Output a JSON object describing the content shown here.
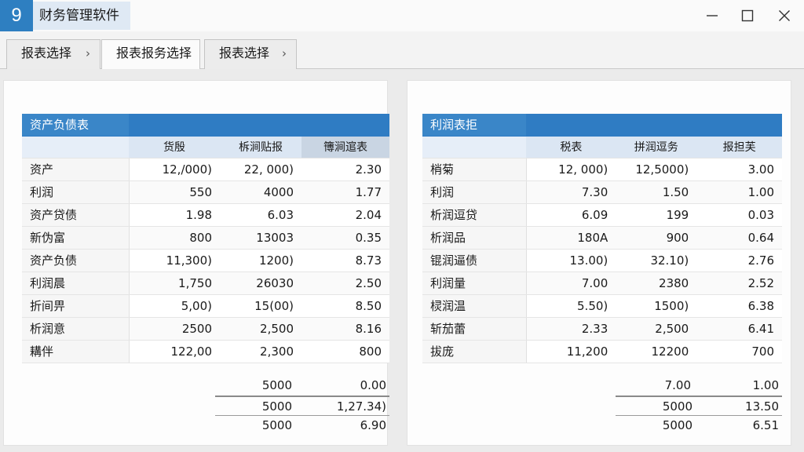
{
  "window": {
    "icon_text": "9",
    "title": "财务管理软件"
  },
  "tabs": [
    {
      "label": "报表选择",
      "chevron": "›"
    },
    {
      "label": "报表报务选择"
    },
    {
      "label": "报表选择",
      "chevron": "›"
    }
  ],
  "icons": [
    "minimize-icon",
    "maximize-icon",
    "close-icon",
    "chevron-right-icon"
  ],
  "left_table": {
    "title": "资产负债表",
    "columns": [
      "货殷",
      "柝涧贴报",
      "簙涧逭表"
    ],
    "rows": [
      [
        "资产",
        "12,/000)",
        "22, 000)",
        "2.30"
      ],
      [
        "利润",
        "550",
        "4000",
        "1.77"
      ],
      [
        "资产贷债",
        "1.98",
        "6.03",
        "2.04"
      ],
      [
        "新伪富",
        "800",
        "13003",
        "0.35"
      ],
      [
        "资产负债",
        "11,300)",
        "1200)",
        "8.73"
      ],
      [
        "利润晨",
        "1,750",
        "26030",
        "2.50"
      ],
      [
        "折间畀",
        "5,00)",
        "15(00)",
        "8.50"
      ],
      [
        "析润意",
        "2500",
        "2,500",
        "8.16"
      ],
      [
        "耩伴",
        "122,00",
        "2,300",
        "800"
      ]
    ],
    "totals": [
      [
        "5000",
        "0.00"
      ],
      [
        "5000",
        "1,27.34)"
      ],
      [
        "5000",
        "6.90"
      ]
    ]
  },
  "right_table": {
    "title": "利润表拒",
    "columns": [
      "税表",
      "拼润逗务",
      "报担芙"
    ],
    "rows": [
      [
        "梢菊",
        "12, 000)",
        "12,5000)",
        "3.00"
      ],
      [
        "利润",
        "7.30",
        "1.50",
        "1.00"
      ],
      [
        "析润逗贷",
        "6.09",
        "199",
        "0.03"
      ],
      [
        "析润品",
        "180A",
        "900",
        "0.64"
      ],
      [
        "锟润逼债",
        "13.00)",
        "32.10)",
        "2.76"
      ],
      [
        "利润量",
        "7.00",
        "2380",
        "2.52"
      ],
      [
        "棂润温",
        "5.50)",
        "1500)",
        "6.38"
      ],
      [
        "斩茄蕾",
        "2.33",
        "2,500",
        "6.41"
      ],
      [
        "拔庞",
        "11,200",
        "12200",
        "700"
      ]
    ],
    "totals": [
      [
        "7.00",
        "1.00"
      ],
      [
        "5000",
        "13.50"
      ],
      [
        "5000",
        "6.51"
      ]
    ]
  },
  "colors": {
    "accent": "#2f7cc3",
    "header_light": "#dbe6f3",
    "title_bg": "#dfe9f4"
  }
}
